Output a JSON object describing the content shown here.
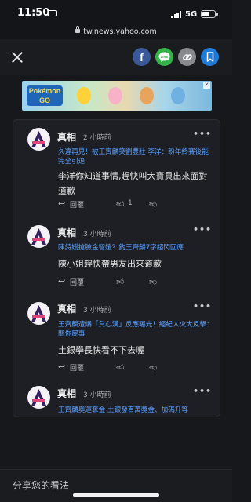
{
  "status_bar": {
    "time": "11:50",
    "network": "5G"
  },
  "url_bar": {
    "domain": "tw.news.yahoo.com"
  },
  "toolbar": {
    "share_buttons": [
      {
        "icon": "facebook-icon",
        "glyph": "f",
        "color": "#3b5998"
      },
      {
        "icon": "line-icon",
        "glyph": "LINE",
        "color": "#34b34a"
      },
      {
        "icon": "link-icon",
        "glyph": "",
        "color": "#888a90"
      },
      {
        "icon": "bookmark-icon",
        "glyph": "",
        "color": "#1f7ad8"
      }
    ]
  },
  "ad": {
    "logo_text_top": "Pokémon",
    "logo_text_bottom": "GO"
  },
  "comments": [
    {
      "name": "真相",
      "time": "2 小時前",
      "ref": "久違再見！被王齊麟笑劉豐壯 李洋：盼年終賽後能完全引退",
      "body": "李洋你知道事情,趕快叫大寶貝出來面對道歉",
      "reply_label": "回覆",
      "likes": "1"
    },
    {
      "name": "真相",
      "time": "3 小時前",
      "ref": "陳詩媛搶臉金智媛？釣王齊麟7字超閃回應",
      "body": "陳小姐趕快帶男友出來道歉",
      "reply_label": "回覆",
      "likes": ""
    },
    {
      "name": "真相",
      "time": "3 小時前",
      "ref": "王齊麟遭爆「負心漢」反應曝光！經紀人火大反擊：關你屁事",
      "body": "土銀學長快看不下去喔",
      "reply_label": "回覆",
      "likes": ""
    },
    {
      "name": "真相",
      "time": "3 小時前",
      "ref": "王齊麟奧運奪金 土銀發百萬獎金、加碼升等",
      "body": "",
      "reply_label": "",
      "likes": ""
    }
  ],
  "bottom_bar": {
    "placeholder": "分享您的看法"
  }
}
